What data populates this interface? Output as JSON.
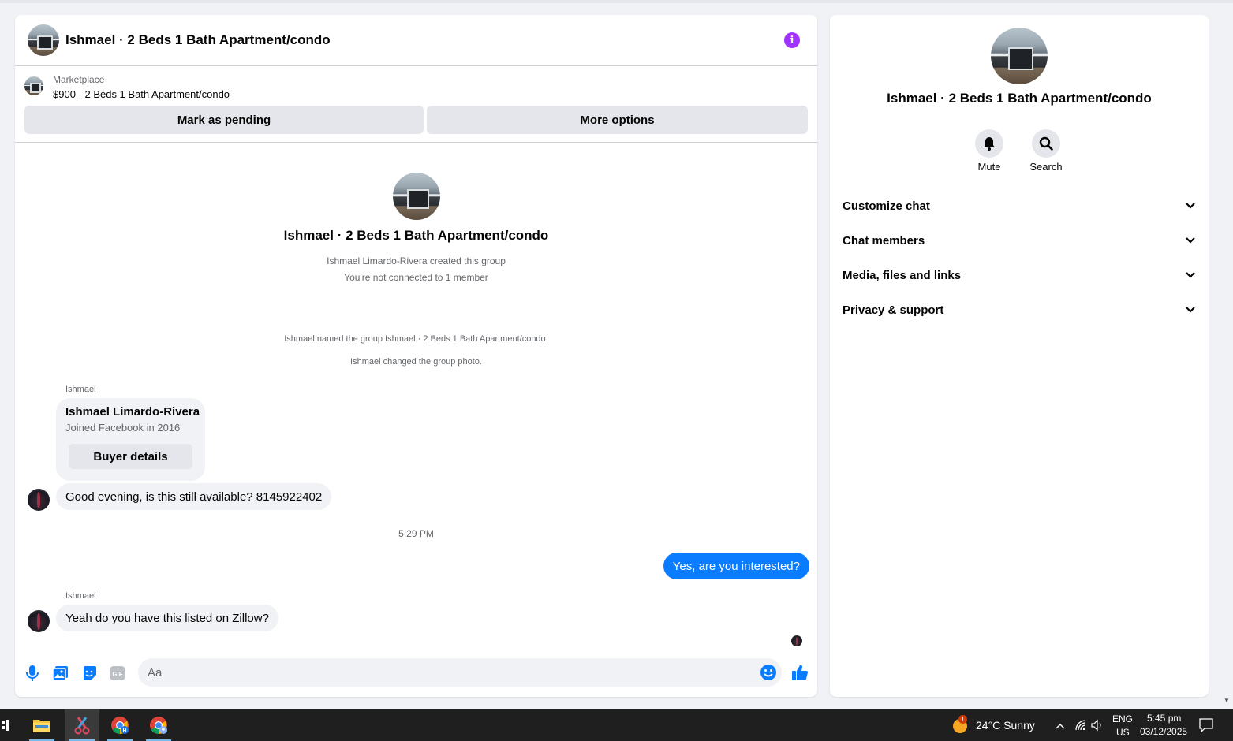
{
  "chat": {
    "title": "Ishmael · 2 Beds 1 Bath Apartment/condo",
    "info_icon": "i",
    "listing": {
      "source": "Marketplace",
      "price_line": "$900 - 2 Beds 1 Bath Apartment/condo",
      "mark_pending_label": "Mark as pending",
      "more_options_label": "More options"
    },
    "intro": {
      "title": "Ishmael · 2 Beds 1 Bath Apartment/condo",
      "created": "Ishmael Limardo-Rivera created this group",
      "connection": "You're not connected to 1 member"
    },
    "system_messages": [
      "Ishmael named the group Ishmael · 2 Beds 1 Bath Apartment/condo.",
      "Ishmael changed the group photo."
    ],
    "messages": {
      "sender_1": "Ishmael",
      "card_name": "Ishmael Limardo-Rivera",
      "card_joined": "Joined Facebook in 2016",
      "card_button": "Buyer details",
      "msg_1": "Good evening, is this still available?  8145922402",
      "timestamp": "5:29 PM",
      "msg_2": "Yes, are you interested?",
      "sender_2": "Ishmael",
      "msg_3": "Yeah do you have this listed on Zillow?"
    },
    "composer": {
      "placeholder": "Aa"
    }
  },
  "info_panel": {
    "title": "Ishmael · 2 Beds 1 Bath Apartment/condo",
    "actions": [
      {
        "label": "Mute",
        "icon": "bell-icon"
      },
      {
        "label": "Search",
        "icon": "search-icon"
      }
    ],
    "sections": [
      "Customize chat",
      "Chat members",
      "Media, files and links",
      "Privacy & support"
    ]
  },
  "taskbar": {
    "weather_badge": "1",
    "weather": "24°C  Sunny",
    "lang_1": "ENG",
    "lang_2": "US",
    "time": "5:45 pm",
    "date": "03/12/2025",
    "apps": [
      "file-explorer-icon",
      "snipping-tool-icon",
      "chrome-icon",
      "chrome-profile-icon"
    ]
  },
  "colors": {
    "accent": "#0a7cff",
    "info": "#a033ff",
    "bubble_in": "#f0f2f5"
  }
}
